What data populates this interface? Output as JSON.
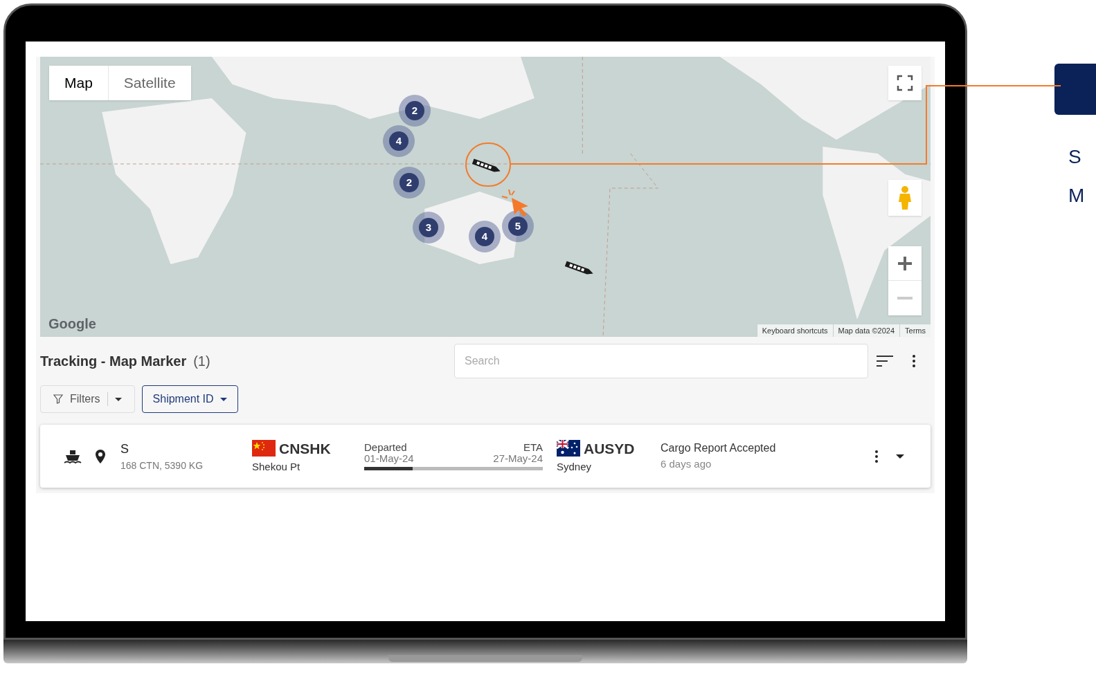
{
  "map": {
    "type_tabs": [
      {
        "label": "Map",
        "selected": true
      },
      {
        "label": "Satellite",
        "selected": false
      }
    ],
    "clusters": [
      {
        "count": "2"
      },
      {
        "count": "4"
      },
      {
        "count": "2"
      },
      {
        "count": "3"
      },
      {
        "count": "4"
      },
      {
        "count": "5"
      }
    ],
    "logo": "Google",
    "attribution": [
      "Keyboard shortcuts",
      "Map data ©2024",
      "Terms"
    ]
  },
  "list": {
    "title": "Tracking - Map Marker",
    "count": "(1)",
    "search": {
      "placeholder": "Search"
    },
    "filters": {
      "label": "Filters"
    },
    "group_by": {
      "label": "Shipment ID"
    }
  },
  "shipments": [
    {
      "name": "S",
      "details": "168 CTN, 5390 KG",
      "origin": {
        "code": "CNSHK",
        "name": "Shekou Pt"
      },
      "departure_label": "Departed",
      "departure_date": "01-May-24",
      "eta_label": "ETA",
      "eta_date": "27-May-24",
      "level": 0.27,
      "destination": {
        "code": "AUSYD",
        "name": "Sydney"
      },
      "status": "Cargo Report Accepted",
      "updated": "6 days ago"
    }
  ],
  "side_panel": {
    "lines": [
      "S",
      "M"
    ]
  }
}
